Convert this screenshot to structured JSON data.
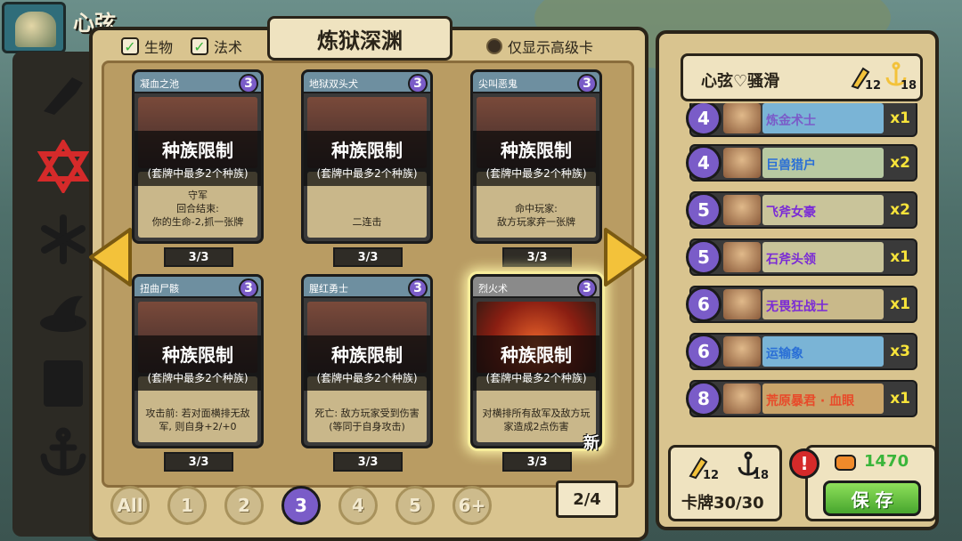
{
  "player": {
    "name": "心弦"
  },
  "filters": {
    "creature_label": "生物",
    "spell_label": "法术",
    "advanced_only_label": "仅显示高级卡"
  },
  "panel_title": "炼狱深渊",
  "restriction": {
    "title": "种族限制",
    "subtitle": "(套牌中最多2个种族)"
  },
  "cards": [
    {
      "name": "凝血之池",
      "cost": "3",
      "desc": "守军\n回合结束:\n你的生命-2,抓一张牌",
      "count": "3/3"
    },
    {
      "name": "地狱双头犬",
      "cost": "3",
      "desc": "二连击",
      "count": "3/3"
    },
    {
      "name": "尖叫恶鬼",
      "cost": "3",
      "desc": "命中玩家:\n敌方玩家弃一张牌",
      "count": "3/3"
    },
    {
      "name": "扭曲尸骸",
      "cost": "3",
      "desc": "攻击前: 若对面横排无敌\n军, 则自身+2/+0",
      "count": "3/3"
    },
    {
      "name": "腥红勇士",
      "cost": "3",
      "desc": "死亡: 敌方玩家受到伤害\n(等同于自身攻击)",
      "count": "3/3"
    },
    {
      "name": "烈火术",
      "cost": "3",
      "desc": "对横排所有敌军及敌方玩\n家造成2点伤害",
      "count": "3/3",
      "badge": "新"
    }
  ],
  "cost_filters": [
    "All",
    "1",
    "2",
    "3",
    "4",
    "5",
    "6+"
  ],
  "active_cost_filter": "3",
  "page_indicator": "2/4",
  "deck": {
    "name": "心弦♡骚滑",
    "attack_stat": "12",
    "anchor_stat": "18",
    "entries": [
      {
        "cost": "4",
        "name": "炼金术士",
        "count": "x1",
        "name_color": "#7a5cc8",
        "bg": "#7ab4d6"
      },
      {
        "cost": "4",
        "name": "巨兽猎户",
        "count": "x2",
        "name_color": "#2a6fd6",
        "bg": "#b8c9a2"
      },
      {
        "cost": "5",
        "name": "飞斧女豪",
        "count": "x2",
        "name_color": "#7a2ad6",
        "bg": "#c9c49a"
      },
      {
        "cost": "5",
        "name": "石斧头领",
        "count": "x1",
        "name_color": "#7a2ad6",
        "bg": "#c9c49a"
      },
      {
        "cost": "6",
        "name": "无畏狂战士",
        "count": "x1",
        "name_color": "#7a2ad6",
        "bg": "#c9b98a"
      },
      {
        "cost": "6",
        "name": "运输象",
        "count": "x3",
        "name_color": "#2a6fd6",
        "bg": "#7ab4d6"
      },
      {
        "cost": "8",
        "name": "荒原暴君 · 血眼",
        "count": "x1",
        "name_color": "#e84a2a",
        "bg": "#c9a46a"
      }
    ]
  },
  "deck_stats": {
    "attack": "12",
    "anchor": "18",
    "cards_label": "卡牌30/30"
  },
  "gold": "1470",
  "save_label": "保 存",
  "colors": {
    "cost_purple": "#7a5cc8",
    "save_green": "#47a52e",
    "gold_green": "#3ab53a",
    "panel_tan": "#d9c48f"
  }
}
